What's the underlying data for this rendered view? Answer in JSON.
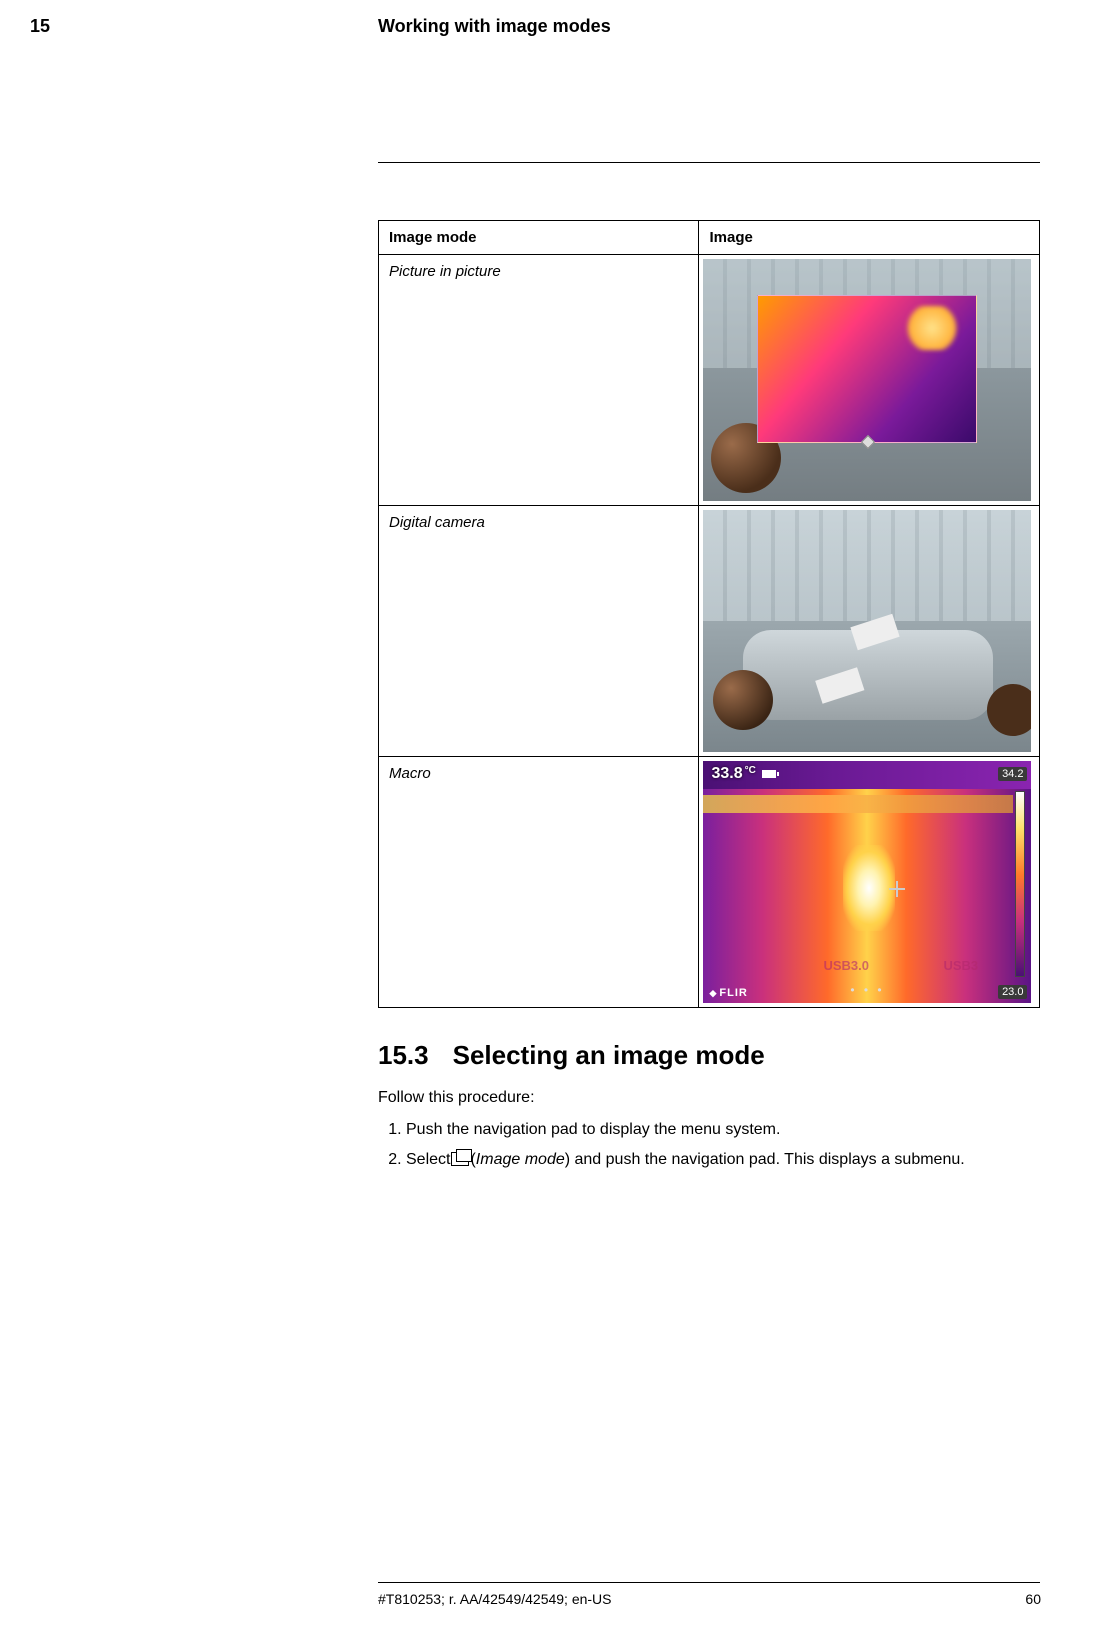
{
  "header": {
    "chapter_number": "15",
    "chapter_title": "Working with image modes"
  },
  "table": {
    "col1_header": "Image mode",
    "col2_header": "Image",
    "rows": [
      {
        "mode": "Picture in picture"
      },
      {
        "mode": "Digital camera"
      },
      {
        "mode": "Macro"
      }
    ]
  },
  "macro_overlay": {
    "temp_value": "33.8",
    "temp_unit": "°C",
    "scale_max": "34.2",
    "scale_min": "23.0",
    "brand": "FLIR",
    "usb_label_1": "USB3.0",
    "usb_label_2": "USB3",
    "dots": "• • •"
  },
  "section": {
    "number": "15.3",
    "title": "Selecting an image mode",
    "intro": "Follow this procedure:",
    "step1": "Push the navigation pad to display the menu system.",
    "step2_a": "Select",
    "step2_b": "(",
    "step2_mode": "Image mode",
    "step2_c": ") and push the navigation pad. This displays a submenu."
  },
  "footer": {
    "doc_id": "#T810253; r. AA/42549/42549; en-US",
    "page_number": "60"
  }
}
